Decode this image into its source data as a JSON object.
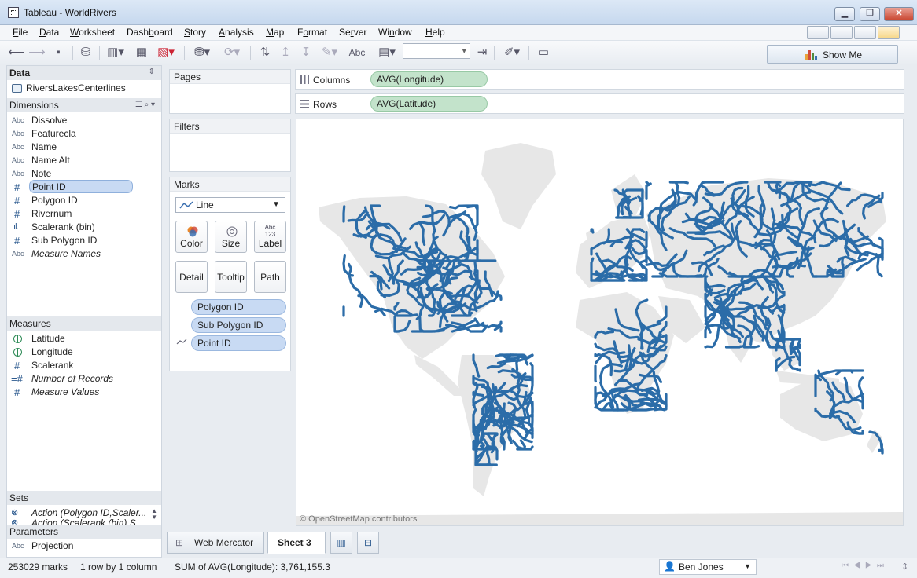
{
  "window": {
    "title": "Tableau - WorldRivers",
    "controls": [
      "▁",
      "❐",
      "✕"
    ]
  },
  "menu": [
    {
      "u": "F",
      "rest": "ile"
    },
    {
      "u": "D",
      "rest": "ata"
    },
    {
      "u": "W",
      "rest": "orksheet"
    },
    {
      "u": "",
      "rest": "Dash",
      "u2": "b",
      "rest2": "oard"
    },
    {
      "u": "S",
      "rest": "tory"
    },
    {
      "u": "A",
      "rest": "nalysis"
    },
    {
      "u": "M",
      "rest": "ap"
    },
    {
      "u": "",
      "rest": "F",
      "u2": "o",
      "rest2": "rmat"
    },
    {
      "u": "",
      "rest": "Se",
      "u2": "r",
      "rest2": "ver"
    },
    {
      "u": "",
      "rest": "Wi",
      "u2": "n",
      "rest2": "dow"
    },
    {
      "u": "H",
      "rest": "elp"
    }
  ],
  "toolbar": {
    "text_button": "Abc",
    "show_me": "Show Me"
  },
  "data_pane": {
    "title": "Data",
    "datasource": "RiversLakesCenterlines",
    "dimensions_header": "Dimensions",
    "dimensions": [
      {
        "type": "Abc",
        "name": "Dissolve"
      },
      {
        "type": "Abc",
        "name": "Featurecla"
      },
      {
        "type": "Abc",
        "name": "Name"
      },
      {
        "type": "Abc",
        "name": "Name Alt"
      },
      {
        "type": "Abc",
        "name": "Note"
      },
      {
        "type": "#",
        "name": "Point ID",
        "selected": true
      },
      {
        "type": "#",
        "name": "Polygon ID"
      },
      {
        "type": "#",
        "name": "Rivernum"
      },
      {
        "type": "bin",
        "name": "Scalerank (bin)"
      },
      {
        "type": "#",
        "name": "Sub Polygon ID"
      },
      {
        "type": "Abc",
        "name": "Measure Names",
        "italic": true
      }
    ],
    "measures_header": "Measures",
    "measures": [
      {
        "type": "globe",
        "name": "Latitude"
      },
      {
        "type": "globe",
        "name": "Longitude"
      },
      {
        "type": "#",
        "name": "Scalerank"
      },
      {
        "type": "=#",
        "name": "Number of Records",
        "italic": true
      },
      {
        "type": "#",
        "name": "Measure Values",
        "italic": true
      }
    ],
    "sets_header": "Sets",
    "sets": [
      "Action (Polygon ID,Scaler...",
      "Action (Scalerank (bin),S..."
    ],
    "parameters_header": "Parameters",
    "parameters": [
      {
        "type": "Abc",
        "name": "Projection"
      }
    ]
  },
  "shelves": {
    "pages": "Pages",
    "filters": "Filters",
    "marks": "Marks",
    "mark_type": "Line",
    "buttons": {
      "color": "Color",
      "size": "Size",
      "label": "Label",
      "label_icon": "Abc\n123",
      "detail": "Detail",
      "tooltip": "Tooltip",
      "path": "Path"
    },
    "mark_pills": [
      "Polygon ID",
      "Sub Polygon ID",
      "Point ID"
    ],
    "columns_label": "Columns",
    "columns_pill": "AVG(Longitude)",
    "rows_label": "Rows",
    "rows_pill": "AVG(Latitude)"
  },
  "map": {
    "attribution": "© OpenStreetMap contributors",
    "river_color": "#2b6ca8",
    "land_color": "#e7e7e7"
  },
  "tabs": [
    {
      "label": "Web Mercator",
      "active": false
    },
    {
      "label": "Sheet 3",
      "active": true
    }
  ],
  "status": {
    "marks": "253029 marks",
    "dims": "1 row by 1 column",
    "sum": "SUM of AVG(Longitude): 3,761,155.3",
    "user": "Ben Jones"
  },
  "colors": {
    "accent_blue_pill": "#c8daf3",
    "accent_green_pill": "#c3e3cb",
    "showme_bars": [
      "#e8a23a",
      "#d14b3a",
      "#4f8a3c",
      "#3a6fb0"
    ]
  }
}
